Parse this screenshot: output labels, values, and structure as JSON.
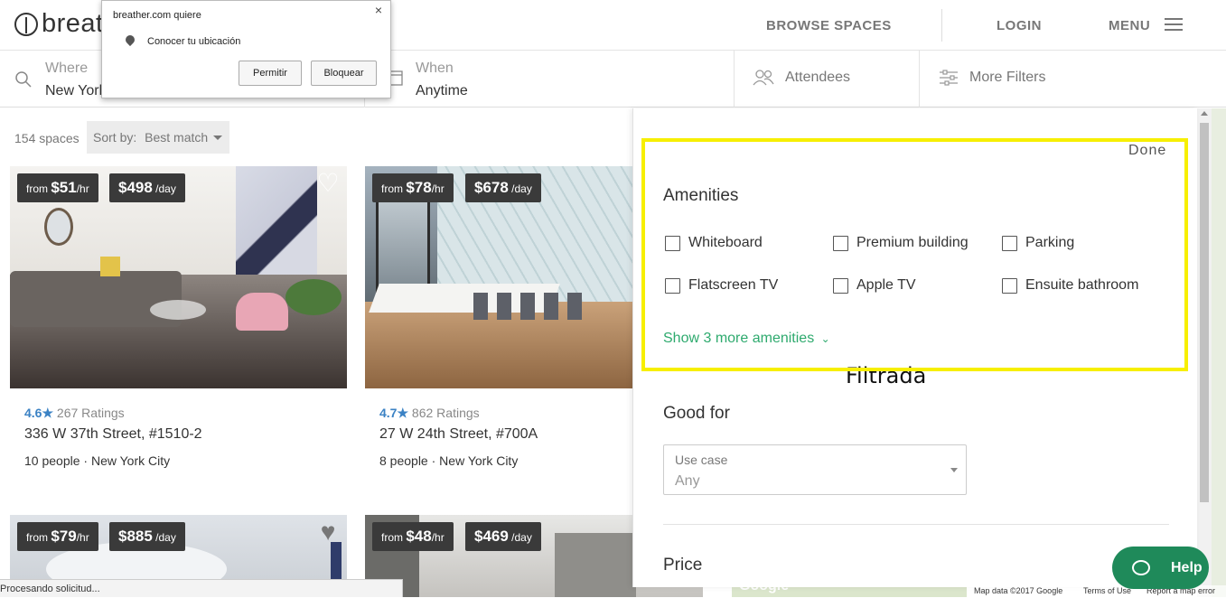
{
  "header": {
    "logo": "breather",
    "nav": {
      "browse": "BROWSE SPACES",
      "login": "LOGIN",
      "menu": "MENU"
    }
  },
  "search": {
    "where_label": "Where",
    "where_value": "New York",
    "when_label": "When",
    "when_value": "Anytime",
    "attendees": "Attendees",
    "more_filters": "More Filters"
  },
  "permission_dialog": {
    "title": "breather.com quiere",
    "request": "Conocer tu ubicación",
    "allow": "Permitir",
    "block": "Bloquear",
    "close": "×"
  },
  "results": {
    "count": "154 spaces",
    "sort_label": "Sort by:",
    "sort_value": "Best match"
  },
  "listings": [
    {
      "from": "from",
      "hourly": "$51",
      "hr": "/hr",
      "daily": "$498",
      "day": "/day",
      "rating": "4.6",
      "ratings": "267 Ratings",
      "address": "336 W 37th Street, #1510-2",
      "people": "10 people",
      "city": "New York City"
    },
    {
      "from": "from",
      "hourly": "$78",
      "hr": "/hr",
      "daily": "$678",
      "day": "/day",
      "rating": "4.7",
      "ratings": "862 Ratings",
      "address": "27 W 24th Street, #700A",
      "people": "8 people",
      "city": "New York City"
    },
    {
      "from": "from",
      "hourly": "$79",
      "hr": "/hr",
      "daily": "$885",
      "day": "/day"
    },
    {
      "from": "from",
      "hourly": "$48",
      "hr": "/hr",
      "daily": "$469",
      "day": "/day"
    }
  ],
  "filters": {
    "done": "Done",
    "amenities_title": "Amenities",
    "amenities": [
      "Whiteboard",
      "Premium building",
      "Parking",
      "Flatscreen TV",
      "Apple TV",
      "Ensuite bathroom"
    ],
    "show_more": "Show 3 more amenities",
    "annotation": "Filtrada",
    "good_for_title": "Good for",
    "use_case_label": "Use case",
    "use_case_value": "Any",
    "price_title": "Price"
  },
  "help": "Help",
  "status_bar": "Procesando solicitud...",
  "map_footer": {
    "data": "Map data ©2017 Google",
    "terms": "Terms of Use",
    "report": "Report a map error",
    "google": "Google"
  },
  "colors": {
    "accent_green": "#2eaa6e",
    "rating_blue": "#3b82c4",
    "highlight": "#f7ef00",
    "help_bg": "#1f8a5a"
  }
}
